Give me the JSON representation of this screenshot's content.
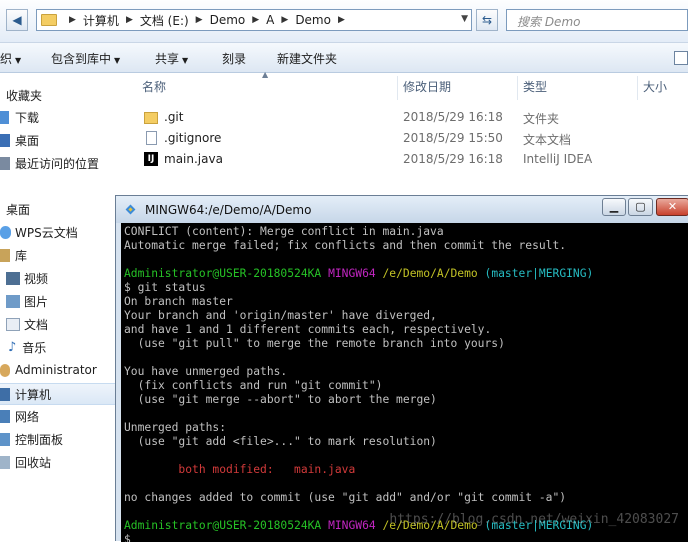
{
  "address": {
    "crumbs": [
      "计算机",
      "文档 (E:)",
      "Demo",
      "A",
      "Demo"
    ],
    "search_placeholder": "搜索 Demo"
  },
  "toolbar": {
    "organize": "织",
    "include_in_library": "包含到库中",
    "share": "共享",
    "burn": "刻录",
    "new_folder": "新建文件夹"
  },
  "sidebar": {
    "favorites": "收藏夹",
    "downloads": "下载",
    "desktop": "桌面",
    "recent": "最近访问的位置",
    "desktop2": "桌面",
    "wps": "WPS云文档",
    "libraries": "库",
    "videos": "视频",
    "pictures": "图片",
    "documents": "文档",
    "music": "音乐",
    "admin": "Administrator",
    "computer": "计算机",
    "network": "网络",
    "control_panel": "控制面板",
    "recycle_bin": "回收站"
  },
  "columns": {
    "name": "名称",
    "modified": "修改日期",
    "type": "类型",
    "size": "大小"
  },
  "files": [
    {
      "name": ".git",
      "date": "2018/5/29 16:18",
      "type": "文件夹",
      "icon": "folder-icon"
    },
    {
      "name": ".gitignore",
      "date": "2018/5/29 15:50",
      "type": "文本文档",
      "icon": "text-file-icon"
    },
    {
      "name": "main.java",
      "date": "2018/5/29 16:18",
      "type": "IntelliJ IDEA",
      "icon": "intellij-file-icon"
    }
  ],
  "terminal": {
    "title": "MINGW64:/e/Demo/A/Demo",
    "user_host": "Administrator@USER-20180524KA",
    "env": "MINGW64",
    "path": "/e/Demo/A/Demo",
    "branch": "(master|MERGING)",
    "lines": {
      "l1": "CONFLICT (content): Merge conflict in main.java",
      "l2": "Automatic merge failed; fix conflicts and then commit the result.",
      "cmd": "$ git status",
      "l4": "On branch master",
      "l5": "Your branch and 'origin/master' have diverged,",
      "l6": "and have 1 and 1 different commits each, respectively.",
      "l7": "  (use \"git pull\" to merge the remote branch into yours)",
      "l8": "You have unmerged paths.",
      "l9": "  (fix conflicts and run \"git commit\")",
      "l10": "  (use \"git merge --abort\" to abort the merge)",
      "l11": "Unmerged paths:",
      "l12": "  (use \"git add <file>...\" to mark resolution)",
      "both_modified": "        both modified:   main.java",
      "l14": "no changes added to commit (use \"git add\" and/or \"git commit -a\")",
      "prompt_end": "$"
    },
    "watermark": "https://blog.csdn.net/weixin_42083027"
  },
  "colors": {
    "green": "#26c226",
    "magenta": "#c226c2",
    "yellow": "#c2c226",
    "cyan": "#26bcc2",
    "red": "#d23a3a"
  }
}
